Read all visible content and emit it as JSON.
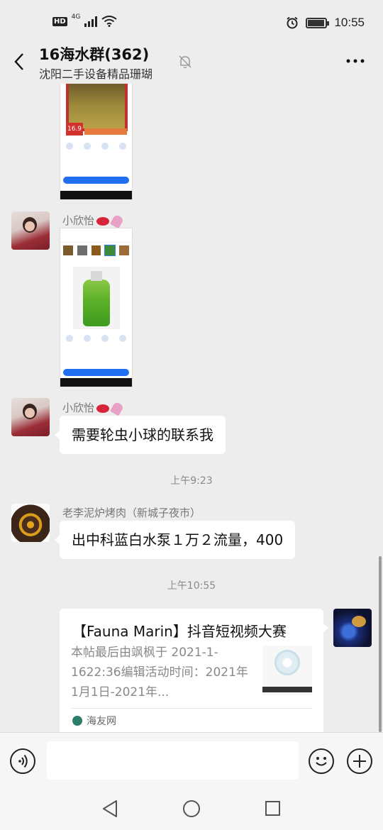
{
  "status_bar": {
    "hd_label": "HD",
    "network": "4G",
    "time": "10:55",
    "battery_percent": 85
  },
  "header": {
    "title": "16海水群(362)",
    "subtitle": "沈阳二手设备精品珊瑚"
  },
  "messages": {
    "m1_sender": "小欣怡",
    "m2_sender": "小欣怡",
    "m2_text": "需要轮虫小球的联系我",
    "ts1": "上午9:23",
    "m3_sender": "老李泥炉烤肉（新城子夜市）",
    "m3_text": "出中科蓝白水泵１万２流量，400",
    "ts2": "上午10:55"
  },
  "shot1": {
    "price": "16.9"
  },
  "link_card": {
    "title": "【Fauna Marin】抖音短视频大赛",
    "description": "本帖最后由飒枫于 2021-1-1622:36编辑活动时间：2021年1月1日-2021年...",
    "source": "海友网"
  },
  "input": {
    "placeholder": "",
    "value": ""
  },
  "colors": {
    "bg": "#ededed",
    "bubble": "#ffffff",
    "accent_blue": "#1f6ff0"
  }
}
